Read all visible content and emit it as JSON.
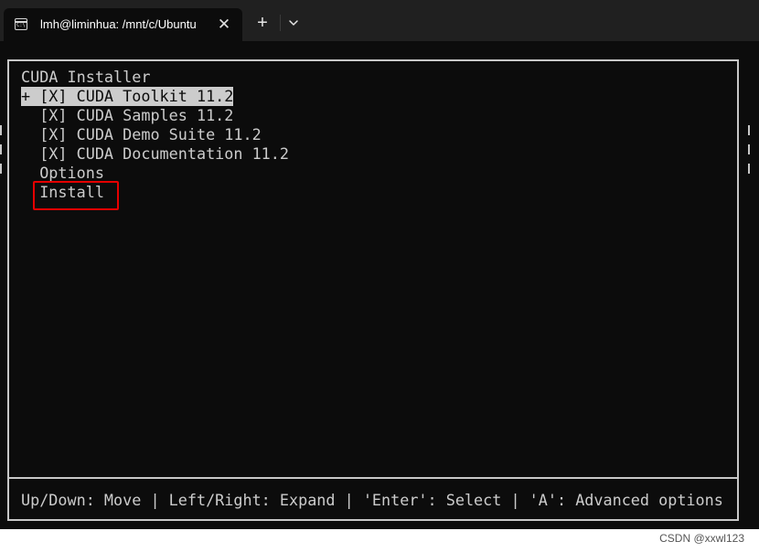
{
  "window": {
    "tab_title": "lmh@liminhua: /mnt/c/Ubuntu",
    "tab_icon": "terminal-icon",
    "tab_icon_glyph": "C:\\",
    "close_icon": "close-icon",
    "new_tab_icon": "plus-icon",
    "dropdown_icon": "chevron-down-icon"
  },
  "installer": {
    "title": "CUDA Installer",
    "items": [
      {
        "text": "+ [X] CUDA Toolkit 11.2",
        "selected": true
      },
      {
        "text": "  [X] CUDA Samples 11.2",
        "selected": false
      },
      {
        "text": "  [X] CUDA Demo Suite 11.2",
        "selected": false
      },
      {
        "text": "  [X] CUDA Documentation 11.2",
        "selected": false
      },
      {
        "text": "  Options",
        "selected": false
      },
      {
        "text": "  Install",
        "selected": false
      }
    ],
    "footer": "Up/Down: Move | Left/Right: Expand | 'Enter': Select | 'A': Advanced options"
  },
  "watermark": "CSDN @xxwl123",
  "colors": {
    "terminal_bg": "#0c0c0c",
    "text": "#cccccc",
    "highlight": "#e60000"
  }
}
